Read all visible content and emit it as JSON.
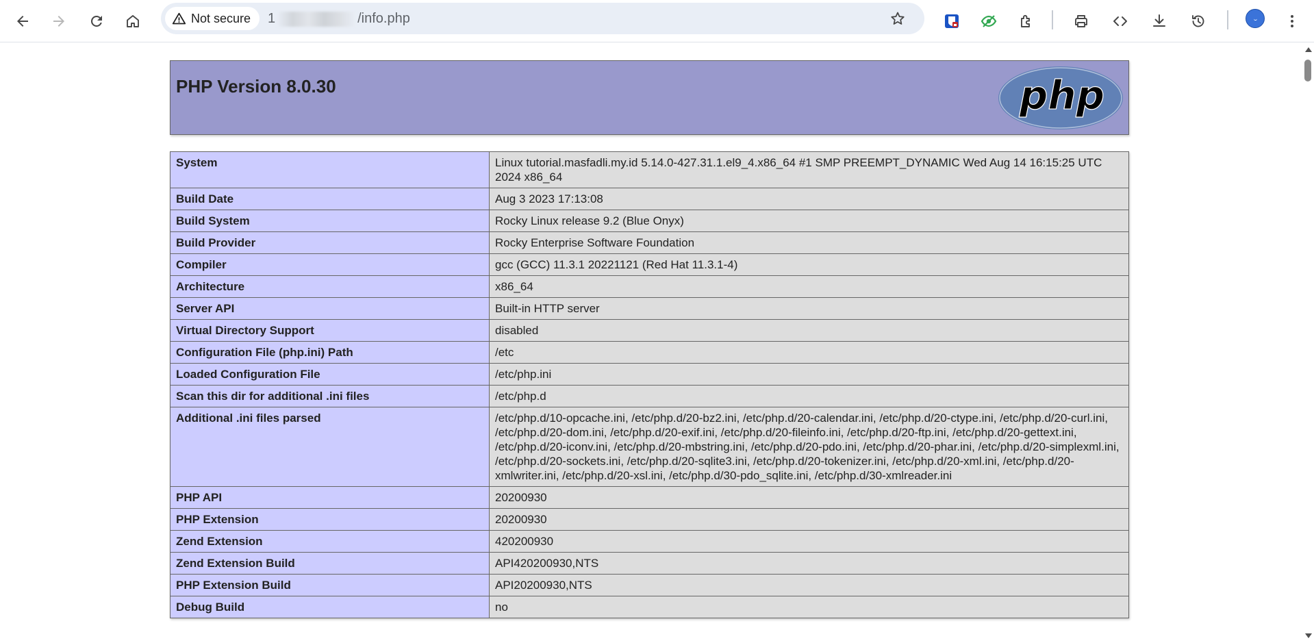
{
  "browser": {
    "security_label": "Not secure",
    "url_prefix": "1",
    "url_suffix": "/info.php",
    "icons": {
      "back": "arrow-left-icon",
      "forward": "arrow-right-icon",
      "reload": "reload-icon",
      "home": "home-icon",
      "warning": "warning-triangle-icon",
      "bookmark": "star-icon",
      "extensions": [
        "password-manager-icon",
        "eye-blocker-icon",
        "puzzle-piece-icon"
      ],
      "actions": [
        "print-icon",
        "code-icon",
        "download-icon",
        "history-icon"
      ],
      "menu": "kebab-menu-icon"
    },
    "colors": {
      "omnibox": "#e9eef6",
      "avatar": "#3b73d9"
    }
  },
  "phpinfo": {
    "title": "PHP Version 8.0.30",
    "logo_text": "php",
    "colors": {
      "header": "#9999cc",
      "label_cell": "#ccccff",
      "value_cell": "#dddddd"
    },
    "rows": [
      {
        "label": "System",
        "value": "Linux tutorial.masfadli.my.id 5.14.0-427.31.1.el9_4.x86_64 #1 SMP PREEMPT_DYNAMIC Wed Aug 14 16:15:25 UTC 2024 x86_64"
      },
      {
        "label": "Build Date",
        "value": "Aug 3 2023 17:13:08"
      },
      {
        "label": "Build System",
        "value": "Rocky Linux release 9.2 (Blue Onyx)"
      },
      {
        "label": "Build Provider",
        "value": "Rocky Enterprise Software Foundation"
      },
      {
        "label": "Compiler",
        "value": "gcc (GCC) 11.3.1 20221121 (Red Hat 11.3.1-4)"
      },
      {
        "label": "Architecture",
        "value": "x86_64"
      },
      {
        "label": "Server API",
        "value": "Built-in HTTP server"
      },
      {
        "label": "Virtual Directory Support",
        "value": "disabled"
      },
      {
        "label": "Configuration File (php.ini) Path",
        "value": "/etc"
      },
      {
        "label": "Loaded Configuration File",
        "value": "/etc/php.ini"
      },
      {
        "label": "Scan this dir for additional .ini files",
        "value": "/etc/php.d"
      },
      {
        "label": "Additional .ini files parsed",
        "value": "/etc/php.d/10-opcache.ini, /etc/php.d/20-bz2.ini, /etc/php.d/20-calendar.ini, /etc/php.d/20-ctype.ini, /etc/php.d/20-curl.ini, /etc/php.d/20-dom.ini, /etc/php.d/20-exif.ini, /etc/php.d/20-fileinfo.ini, /etc/php.d/20-ftp.ini, /etc/php.d/20-gettext.ini, /etc/php.d/20-iconv.ini, /etc/php.d/20-mbstring.ini, /etc/php.d/20-pdo.ini, /etc/php.d/20-phar.ini, /etc/php.d/20-simplexml.ini, /etc/php.d/20-sockets.ini, /etc/php.d/20-sqlite3.ini, /etc/php.d/20-tokenizer.ini, /etc/php.d/20-xml.ini, /etc/php.d/20-xmlwriter.ini, /etc/php.d/20-xsl.ini, /etc/php.d/30-pdo_sqlite.ini, /etc/php.d/30-xmlreader.ini"
      },
      {
        "label": "PHP API",
        "value": "20200930"
      },
      {
        "label": "PHP Extension",
        "value": "20200930"
      },
      {
        "label": "Zend Extension",
        "value": "420200930"
      },
      {
        "label": "Zend Extension Build",
        "value": "API420200930,NTS"
      },
      {
        "label": "PHP Extension Build",
        "value": "API20200930,NTS"
      },
      {
        "label": "Debug Build",
        "value": "no"
      }
    ]
  }
}
